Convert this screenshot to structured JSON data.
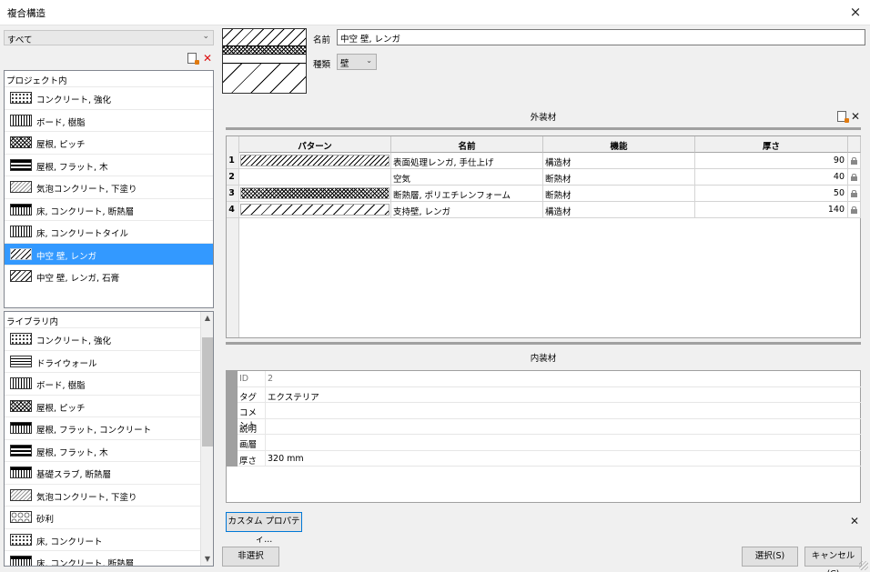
{
  "window": {
    "title": "複合構造",
    "close_label": "×"
  },
  "filter": {
    "value": "すべて",
    "arrow": "⌄"
  },
  "project_list": {
    "header": "プロジェクト内",
    "items": [
      {
        "label": "コンクリート, 強化",
        "pattern": "dots"
      },
      {
        "label": "ボード, 樹脂",
        "pattern": "vert"
      },
      {
        "label": "屋根, ピッチ",
        "pattern": "cross"
      },
      {
        "label": "屋根, フラット, 木",
        "pattern": "band"
      },
      {
        "label": "気泡コンクリート, 下塗り",
        "pattern": "hatch-grey"
      },
      {
        "label": "床, コンクリート, 断熱層",
        "pattern": "bandd"
      },
      {
        "label": "床, コンクリートタイル",
        "pattern": "vert"
      },
      {
        "label": "中空 壁, レンガ",
        "pattern": "diag",
        "selected": true
      },
      {
        "label": "中空 壁, レンガ, 石膏",
        "pattern": "diag"
      }
    ]
  },
  "library_list": {
    "header": "ライブラリ内",
    "items": [
      {
        "label": "コンクリート, 強化",
        "pattern": "dots"
      },
      {
        "label": "ドライウォール",
        "pattern": "horiz"
      },
      {
        "label": "ボード, 樹脂",
        "pattern": "vert"
      },
      {
        "label": "屋根, ピッチ",
        "pattern": "cross"
      },
      {
        "label": "屋根, フラット, コンクリート",
        "pattern": "bandd"
      },
      {
        "label": "屋根, フラット, 木",
        "pattern": "band"
      },
      {
        "label": "基礎スラブ, 断熱層",
        "pattern": "bandd"
      },
      {
        "label": "気泡コンクリート, 下塗り",
        "pattern": "hatch-grey"
      },
      {
        "label": "砂利",
        "pattern": "gravel"
      },
      {
        "label": "床, コンクリート",
        "pattern": "dots"
      },
      {
        "label": "床, コンクリート, 断熱層",
        "pattern": "bandd"
      }
    ]
  },
  "detail": {
    "name_label": "名前",
    "name_value": "中空 壁, レンガ",
    "kind_label": "種類",
    "kind_value": "壁",
    "kind_arrow": "⌄"
  },
  "exterior": {
    "title": "外装材",
    "columns": [
      "パターン",
      "名前",
      "機能",
      "厚さ"
    ],
    "rows": [
      {
        "index": "1",
        "pattern": "diag",
        "name": "表面処理レンガ, 手仕上げ",
        "function": "構造材",
        "thickness": "90"
      },
      {
        "index": "2",
        "pattern": "none",
        "name": "空気",
        "function": "断熱材",
        "thickness": "40"
      },
      {
        "index": "3",
        "pattern": "cross",
        "name": "断熱層, ポリエチレンフォーム",
        "function": "断熱材",
        "thickness": "50"
      },
      {
        "index": "4",
        "pattern": "diag-wide",
        "name": "支持壁, レンガ",
        "function": "構造材",
        "thickness": "140"
      }
    ]
  },
  "interior": {
    "title": "内装材"
  },
  "properties": [
    {
      "key": "ID",
      "value": "2",
      "muted": true
    },
    {
      "key": "タグ",
      "value": "エクステリア"
    },
    {
      "key": "コメント",
      "value": ""
    },
    {
      "key": "説明",
      "value": ""
    },
    {
      "key": "画層",
      "value": ""
    },
    {
      "key": "厚さ",
      "value": "320 mm"
    }
  ],
  "buttons": {
    "custom_props": "カスタム プロパティ...",
    "deselect": "非選択",
    "select": "選択(S)",
    "cancel": "キャンセル(C)"
  },
  "colors": {
    "selection": "#3399ff",
    "focus_border": "#0078d7",
    "delete_icon": "#dd1111"
  }
}
